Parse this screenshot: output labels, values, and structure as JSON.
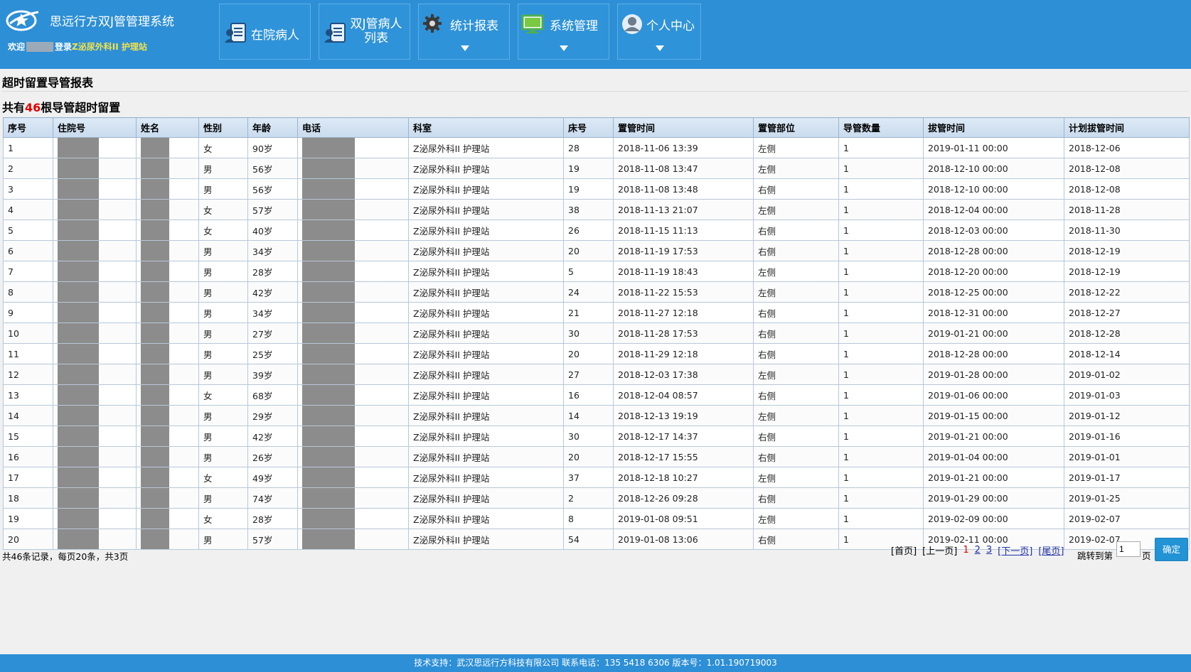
{
  "header": {
    "app_title": "思远行方双J管管理系统",
    "welcome_prefix": "欢迎",
    "welcome_suffix": "登录",
    "department": "Z泌尿外科II 护理站",
    "nav": [
      {
        "label": "在院病人",
        "icon": "patient-card-icon"
      },
      {
        "label": "双J管病人\n列表",
        "icon": "patient-list-icon"
      },
      {
        "label": "统计报表",
        "icon": "gear-icon"
      },
      {
        "label": "系统管理",
        "icon": "monitor-icon"
      },
      {
        "label": "个人中心",
        "icon": "user-icon"
      }
    ]
  },
  "report": {
    "title": "超时留置导管报表",
    "summary_prefix": "共有",
    "summary_count": "46",
    "summary_suffix": "根导管超时留置"
  },
  "table": {
    "columns": [
      "序号",
      "住院号",
      "姓名",
      "性别",
      "年龄",
      "电话",
      "科室",
      "床号",
      "置管时间",
      "置管部位",
      "导管数量",
      "拔管时间",
      "计划拔管时间"
    ],
    "rows": [
      [
        "1",
        "",
        "",
        "女",
        "90岁",
        "",
        "Z泌尿外科II 护理站",
        "28",
        "2018-11-06 13:39",
        "左侧",
        "1",
        "2019-01-11 00:00",
        "2018-12-06"
      ],
      [
        "2",
        "",
        "",
        "男",
        "56岁",
        "",
        "Z泌尿外科II 护理站",
        "19",
        "2018-11-08 13:47",
        "左侧",
        "1",
        "2018-12-10 00:00",
        "2018-12-08"
      ],
      [
        "3",
        "",
        "",
        "男",
        "56岁",
        "",
        "Z泌尿外科II 护理站",
        "19",
        "2018-11-08 13:48",
        "右侧",
        "1",
        "2018-12-10 00:00",
        "2018-12-08"
      ],
      [
        "4",
        "",
        "",
        "女",
        "57岁",
        "",
        "Z泌尿外科II 护理站",
        "38",
        "2018-11-13 21:07",
        "左侧",
        "1",
        "2018-12-04 00:00",
        "2018-11-28"
      ],
      [
        "5",
        "",
        "",
        "女",
        "40岁",
        "",
        "Z泌尿外科II 护理站",
        "26",
        "2018-11-15 11:13",
        "右侧",
        "1",
        "2018-12-03 00:00",
        "2018-11-30"
      ],
      [
        "6",
        "",
        "",
        "男",
        "34岁",
        "",
        "Z泌尿外科II 护理站",
        "20",
        "2018-11-19 17:53",
        "右侧",
        "1",
        "2018-12-28 00:00",
        "2018-12-19"
      ],
      [
        "7",
        "",
        "",
        "男",
        "28岁",
        "",
        "Z泌尿外科II 护理站",
        "5",
        "2018-11-19 18:43",
        "左侧",
        "1",
        "2018-12-20 00:00",
        "2018-12-19"
      ],
      [
        "8",
        "",
        "",
        "男",
        "42岁",
        "",
        "Z泌尿外科II 护理站",
        "24",
        "2018-11-22 15:53",
        "左侧",
        "1",
        "2018-12-25 00:00",
        "2018-12-22"
      ],
      [
        "9",
        "",
        "",
        "男",
        "34岁",
        "",
        "Z泌尿外科II 护理站",
        "21",
        "2018-11-27 12:18",
        "右侧",
        "1",
        "2018-12-31 00:00",
        "2018-12-27"
      ],
      [
        "10",
        "",
        "",
        "男",
        "27岁",
        "",
        "Z泌尿外科II 护理站",
        "30",
        "2018-11-28 17:53",
        "右侧",
        "1",
        "2019-01-21 00:00",
        "2018-12-28"
      ],
      [
        "11",
        "",
        "",
        "男",
        "25岁",
        "",
        "Z泌尿外科II 护理站",
        "20",
        "2018-11-29 12:18",
        "右侧",
        "1",
        "2018-12-28 00:00",
        "2018-12-14"
      ],
      [
        "12",
        "",
        "",
        "男",
        "39岁",
        "",
        "Z泌尿外科II 护理站",
        "27",
        "2018-12-03 17:38",
        "左侧",
        "1",
        "2019-01-28 00:00",
        "2019-01-02"
      ],
      [
        "13",
        "",
        "",
        "女",
        "68岁",
        "",
        "Z泌尿外科II 护理站",
        "16",
        "2018-12-04 08:57",
        "右侧",
        "1",
        "2019-01-06 00:00",
        "2019-01-03"
      ],
      [
        "14",
        "",
        "",
        "男",
        "29岁",
        "",
        "Z泌尿外科II 护理站",
        "14",
        "2018-12-13 19:19",
        "左侧",
        "1",
        "2019-01-15 00:00",
        "2019-01-12"
      ],
      [
        "15",
        "",
        "",
        "男",
        "42岁",
        "",
        "Z泌尿外科II 护理站",
        "30",
        "2018-12-17 14:37",
        "右侧",
        "1",
        "2019-01-21 00:00",
        "2019-01-16"
      ],
      [
        "16",
        "",
        "",
        "男",
        "26岁",
        "",
        "Z泌尿外科II 护理站",
        "20",
        "2018-12-17 15:55",
        "右侧",
        "1",
        "2019-01-04 00:00",
        "2019-01-01"
      ],
      [
        "17",
        "",
        "",
        "女",
        "49岁",
        "",
        "Z泌尿外科II 护理站",
        "37",
        "2018-12-18 10:27",
        "左侧",
        "1",
        "2019-01-21 00:00",
        "2019-01-17"
      ],
      [
        "18",
        "",
        "",
        "男",
        "74岁",
        "",
        "Z泌尿外科II 护理站",
        "2",
        "2018-12-26 09:28",
        "右侧",
        "1",
        "2019-01-29 00:00",
        "2019-01-25"
      ],
      [
        "19",
        "",
        "",
        "女",
        "28岁",
        "",
        "Z泌尿外科II 护理站",
        "8",
        "2019-01-08 09:51",
        "左侧",
        "1",
        "2019-02-09 00:00",
        "2019-02-07"
      ],
      [
        "20",
        "",
        "",
        "男",
        "57岁",
        "",
        "Z泌尿外科II 护理站",
        "54",
        "2019-01-08 13:06",
        "右侧",
        "1",
        "2019-02-11 00:00",
        "2019-02-07"
      ]
    ]
  },
  "pagination": {
    "summary": "共46条记录，每页20条，共3页",
    "first": "[首页]",
    "prev": "[上一页]",
    "pages": [
      "1",
      "2",
      "3"
    ],
    "current": "1",
    "next": "[下一页]",
    "last": "[尾页]",
    "jump_label": "跳转到第",
    "jump_value": "1",
    "jump_unit": "页",
    "ok": "确定"
  },
  "footer": {
    "text": "技术支持：武汉思远行方科技有限公司   联系电话：135 5418 6306   版本号：1.01.190719003"
  },
  "colors": {
    "header_bg": "#2d8fd6",
    "accent_red": "#e10000",
    "dept_yellow": "#f3e24a",
    "mask_gray": "#8c8c8c"
  }
}
